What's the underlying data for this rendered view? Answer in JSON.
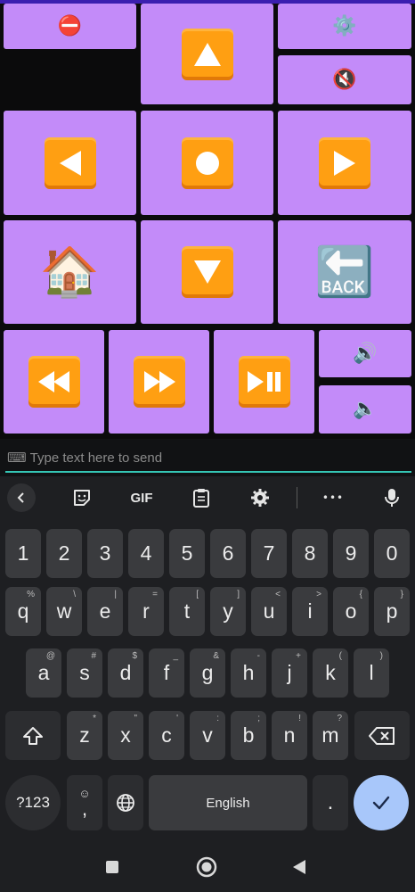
{
  "remote": {
    "buttons": [
      {
        "id": "stop",
        "icon": "no-entry-icon",
        "glyph": "⛔"
      },
      {
        "id": "up",
        "icon": "arrow-up-icon"
      },
      {
        "id": "settings",
        "icon": "gear-icon",
        "glyph": "⚙️"
      },
      {
        "id": "mute",
        "icon": "mute-icon",
        "glyph": "🔇"
      },
      {
        "id": "left",
        "icon": "arrow-left-icon"
      },
      {
        "id": "ok",
        "icon": "record-button-icon"
      },
      {
        "id": "right",
        "icon": "arrow-right-icon"
      },
      {
        "id": "home",
        "icon": "house-icon",
        "glyph": "🏠"
      },
      {
        "id": "down",
        "icon": "arrow-down-icon"
      },
      {
        "id": "back",
        "icon": "back-arrow-icon",
        "glyph": "🔙"
      },
      {
        "id": "rewind",
        "icon": "rewind-icon"
      },
      {
        "id": "fastforward",
        "icon": "fast-forward-icon"
      },
      {
        "id": "playpause",
        "icon": "play-pause-icon"
      },
      {
        "id": "volume_up",
        "icon": "speaker-high-icon",
        "glyph": "🔊"
      },
      {
        "id": "volume_down",
        "icon": "speaker-low-icon",
        "glyph": "🔈"
      }
    ]
  },
  "text_input": {
    "keyboard_glyph": "⌨",
    "placeholder": "Type text here to send"
  },
  "keyboard": {
    "toolbar": {
      "gif_label": "GIF",
      "more_label": "•••"
    },
    "number_row": [
      "1",
      "2",
      "3",
      "4",
      "5",
      "6",
      "7",
      "8",
      "9",
      "0"
    ],
    "row1": [
      {
        "k": "q",
        "h": "%"
      },
      {
        "k": "w",
        "h": "\\"
      },
      {
        "k": "e",
        "h": "|"
      },
      {
        "k": "r",
        "h": "="
      },
      {
        "k": "t",
        "h": "["
      },
      {
        "k": "y",
        "h": "]"
      },
      {
        "k": "u",
        "h": "<"
      },
      {
        "k": "i",
        "h": ">"
      },
      {
        "k": "o",
        "h": "{"
      },
      {
        "k": "p",
        "h": "}"
      }
    ],
    "row2": [
      {
        "k": "a",
        "h": "@"
      },
      {
        "k": "s",
        "h": "#"
      },
      {
        "k": "d",
        "h": "$"
      },
      {
        "k": "f",
        "h": "_"
      },
      {
        "k": "g",
        "h": "&"
      },
      {
        "k": "h",
        "h": "-"
      },
      {
        "k": "j",
        "h": "+"
      },
      {
        "k": "k",
        "h": "("
      },
      {
        "k": "l",
        "h": ")"
      }
    ],
    "row3": [
      {
        "k": "z",
        "h": "*"
      },
      {
        "k": "x",
        "h": "\""
      },
      {
        "k": "c",
        "h": "'"
      },
      {
        "k": "v",
        "h": ":"
      },
      {
        "k": "b",
        "h": ";"
      },
      {
        "k": "n",
        "h": "!"
      },
      {
        "k": "m",
        "h": "?"
      }
    ],
    "symbols_label": "?123",
    "emoji_hint": "☺",
    "comma_label": ",",
    "space_label": "English",
    "period_label": ".",
    "accent_color": "#a8c7fa"
  },
  "colors": {
    "button_bg": "#c38bf9",
    "tile_orange": "#ff9f12",
    "underline": "#35c6b5"
  }
}
